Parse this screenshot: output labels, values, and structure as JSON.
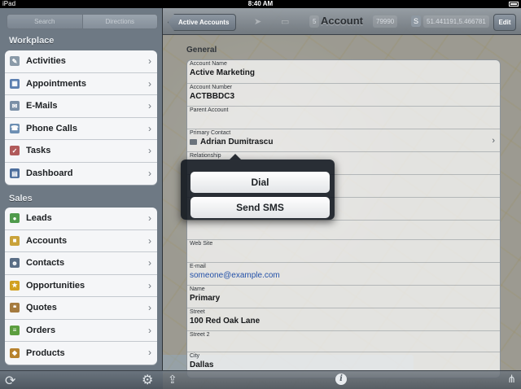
{
  "status_bar": {
    "carrier": "iPad",
    "time": "8:40 AM"
  },
  "sidebar": {
    "segments": [
      "Search",
      "Directions"
    ],
    "sections": [
      {
        "title": "Workplace",
        "items": [
          {
            "label": "Activities",
            "icon": "notepad-icon",
            "color": "#8a9aa8"
          },
          {
            "label": "Appointments",
            "icon": "calendar-icon",
            "color": "#5c7fb0"
          },
          {
            "label": "E-Mails",
            "icon": "email-icon",
            "color": "#7a8fa6"
          },
          {
            "label": "Phone Calls",
            "icon": "phone-icon",
            "color": "#6d8fb3"
          },
          {
            "label": "Tasks",
            "icon": "tasks-icon",
            "color": "#b05a5a"
          },
          {
            "label": "Dashboard",
            "icon": "dashboard-icon",
            "color": "#4c6e9c"
          }
        ]
      },
      {
        "title": "Sales",
        "items": [
          {
            "label": "Leads",
            "icon": "leads-icon",
            "color": "#4f9a4c"
          },
          {
            "label": "Accounts",
            "icon": "accounts-icon",
            "color": "#c9a23a"
          },
          {
            "label": "Contacts",
            "icon": "contacts-icon",
            "color": "#5a6e86"
          },
          {
            "label": "Opportunities",
            "icon": "opportunities-icon",
            "color": "#d1a020"
          },
          {
            "label": "Quotes",
            "icon": "quotes-icon",
            "color": "#a57b3f"
          },
          {
            "label": "Orders",
            "icon": "orders-icon",
            "color": "#5c9e3f"
          },
          {
            "label": "Products",
            "icon": "products-icon",
            "color": "#b7822e"
          }
        ]
      }
    ]
  },
  "navbar": {
    "back_label": "Active Accounts",
    "title": "Account",
    "edit_label": "Edit",
    "coord_left": "5",
    "coord_left_tail": "79990",
    "coord_right": "51.441191,5.466781"
  },
  "form": {
    "section_title": "General",
    "fields": [
      {
        "label": "Account Name",
        "value": "Active Marketing"
      },
      {
        "label": "Account Number",
        "value": "ACTBBDC3"
      },
      {
        "label": "Parent Account",
        "value": ""
      },
      {
        "label": "Primary Contact",
        "value": "Adrian Dumitrascu"
      },
      {
        "label": "Relationship",
        "value": ""
      },
      {
        "label": "Web Site",
        "value": ""
      },
      {
        "label": "E-mail",
        "value": "someone@example.com"
      },
      {
        "label": "Name",
        "value": "Primary"
      },
      {
        "label": "Street",
        "value": "100 Red Oak Lane"
      },
      {
        "label": "Street 2",
        "value": ""
      },
      {
        "label": "City",
        "value": "Dallas"
      }
    ]
  },
  "popup": {
    "dial_label": "Dial",
    "sms_label": "Send SMS"
  }
}
